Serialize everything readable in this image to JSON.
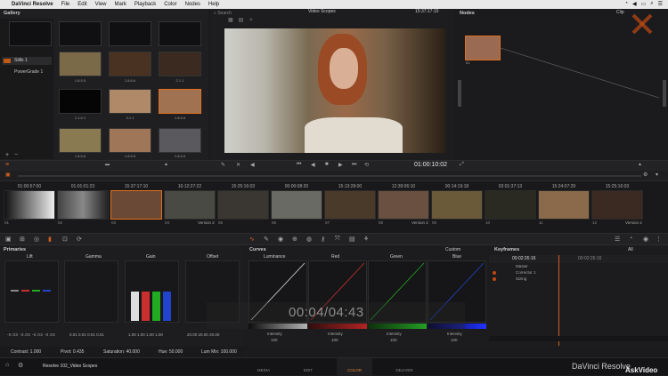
{
  "menubar": {
    "apple": "",
    "app": "DaVinci Resolve",
    "items": [
      "File",
      "Edit",
      "View",
      "Mark",
      "Playback",
      "Color",
      "Nodes",
      "Help"
    ]
  },
  "gallery": {
    "title": "Gallery",
    "items": [
      "Stills 1",
      "PowerGrade 1"
    ],
    "thumbs": [
      {
        "label": "",
        "color": "#101012"
      },
      {
        "label": "",
        "color": "#101012"
      },
      {
        "label": "",
        "color": "#101012"
      },
      {
        "label": "",
        "color": "#101012"
      },
      {
        "label": "1.8.5.5",
        "color": "#7a6a48"
      },
      {
        "label": "1.8.6.6",
        "color": "#4a3222"
      },
      {
        "label": "2.1.1",
        "color": "#3a2a20"
      },
      {
        "label": "1.1.6.1",
        "color": "#050505"
      },
      {
        "label": "3.1.1",
        "color": "#b08a68"
      },
      {
        "label": "1.8.6.6",
        "color": "#a07252"
      },
      {
        "label": "1.8.6.6",
        "color": "#8a7a52"
      },
      {
        "label": "1.8.6.6",
        "color": "#a07658"
      },
      {
        "label": "1.8.6.6",
        "color": "#5a5a5e"
      }
    ]
  },
  "viewer": {
    "search": "Search",
    "title": "Video Scopes",
    "timecode_top": "15:37:17:10",
    "timecode": "01:00:10:02"
  },
  "nodes": {
    "title": "Nodes",
    "clip": "Clip",
    "node_label": "01"
  },
  "timeline": {
    "timecodes": [
      "01:00:57:00",
      "01:01:01:23",
      "15:37:17:10",
      "16:12:27:22",
      "15:25:16:03",
      "00:00:08:20",
      "15:13:28:00",
      "12:39:06:10",
      "00:14:19:18",
      "03:01:37:13",
      "15:24:07:29",
      "15:25:16:03"
    ],
    "nums": [
      "01",
      "02",
      "03",
      "04",
      "05",
      "06",
      "07",
      "08",
      "09",
      "10",
      "11",
      "12"
    ],
    "versions": [
      "Version 2",
      "Version 2",
      "Version 2"
    ],
    "clip_colors": [
      "#2a2a2a",
      "#222",
      "#5a3a2a",
      "#4a4a44",
      "#303030",
      "#6a6a64",
      "#4a3a2a",
      "#6a5040",
      "#6a5a3a",
      "#2a2a22",
      "#8a6a4a",
      "#3a2a22"
    ]
  },
  "color": {
    "primaries": {
      "title": "Primaries",
      "wheels": [
        "Lift",
        "Gamma",
        "Gain",
        "Offset"
      ],
      "vals_lift": [
        "-0.03",
        "-0.03",
        "-0.03",
        "-0.03"
      ],
      "vals_gamma": [
        "0.01",
        "0.01",
        "0.01",
        "0.01"
      ],
      "vals_gain": [
        "1.00",
        "1.00",
        "1.00",
        "1.00"
      ],
      "vals_offset": [
        "20.00",
        "20.00",
        "20.00",
        "20.00"
      ],
      "labels": [
        "Y",
        "R",
        "G",
        "B"
      ]
    },
    "footer": {
      "contrast": "Contrast: 1.000",
      "pivot": "Pivot: 0.435",
      "saturation": "Saturation: 40.000",
      "hue": "Hue: 50.000",
      "lum": "Lum Mix: 100.000"
    },
    "curves": {
      "title": "Curves",
      "mode": "Custom",
      "channels": [
        "Luminance",
        "Red",
        "Green",
        "Blue"
      ],
      "intensity": "Intensity",
      "intensity_val": "100"
    },
    "overlay_time": "00:04/04:43",
    "keyframes": {
      "title": "Keyframes",
      "filter": "All",
      "tc1": "00:02:26:16",
      "tc2": "00:02:26:16",
      "rows": [
        "Master",
        "Corrector 1",
        "Sizing"
      ]
    }
  },
  "bottom": {
    "project": "Resolve 102_Video Scopes",
    "tabs": [
      "MEDIA",
      "EDIT",
      "COLOR",
      "DELIVER"
    ],
    "brand": "DaVinci Resolve",
    "watermark": "AskVideo"
  },
  "colors": {
    "accent": "#e05a10",
    "red": "#c83030",
    "green": "#22aa22",
    "blue": "#2244cc"
  }
}
